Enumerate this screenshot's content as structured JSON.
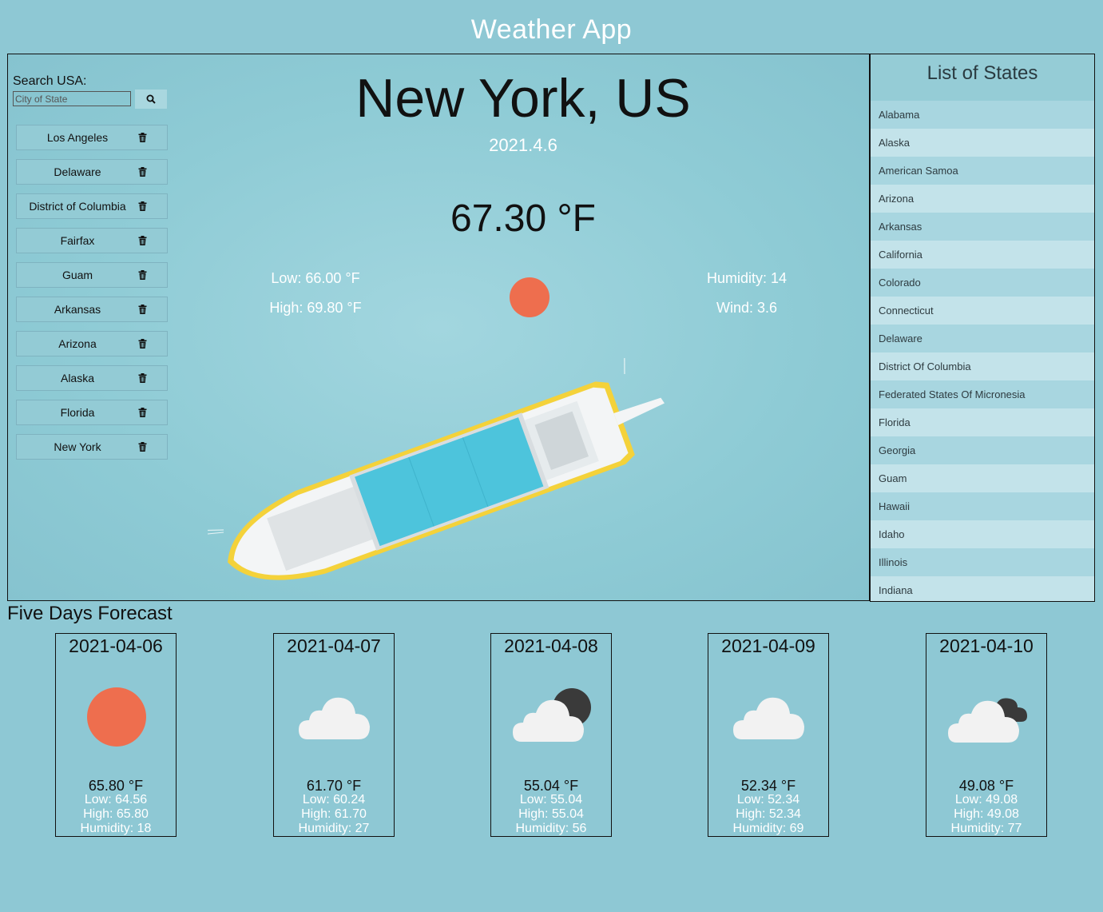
{
  "app_title": "Weather App",
  "search": {
    "label": "Search USA:",
    "placeholder": "City of State",
    "button_icon": "search-icon"
  },
  "history": [
    {
      "label": "Los Angeles"
    },
    {
      "label": "Delaware"
    },
    {
      "label": "District of Columbia"
    },
    {
      "label": "Fairfax"
    },
    {
      "label": "Guam"
    },
    {
      "label": "Arkansas"
    },
    {
      "label": "Arizona"
    },
    {
      "label": "Alaska"
    },
    {
      "label": "Florida"
    },
    {
      "label": "New York"
    }
  ],
  "current": {
    "city": "New York, US",
    "date": "2021.4.6",
    "temp": "67.30 °F",
    "low": "Low: 66.00 °F",
    "high": "High: 69.80 °F",
    "humidity": "Humidity: 14",
    "wind": "Wind: 3.6",
    "icon": "sun-icon"
  },
  "states": {
    "title": "List of States",
    "items": [
      "Alabama",
      "Alaska",
      "American Samoa",
      "Arizona",
      "Arkansas",
      "California",
      "Colorado",
      "Connecticut",
      "Delaware",
      "District Of Columbia",
      "Federated States Of Micronesia",
      "Florida",
      "Georgia",
      "Guam",
      "Hawaii",
      "Idaho",
      "Illinois",
      "Indiana"
    ]
  },
  "forecast": {
    "title": "Five Days Forecast",
    "days": [
      {
        "date": "2021-04-06",
        "temp": "65.80 °F",
        "low": "Low: 64.56",
        "high": "High: 65.80",
        "humidity": "Humidity: 18",
        "icon": "sun-icon"
      },
      {
        "date": "2021-04-07",
        "temp": "61.70 °F",
        "low": "Low: 60.24",
        "high": "High: 61.70",
        "humidity": "Humidity: 27",
        "icon": "cloud-icon"
      },
      {
        "date": "2021-04-08",
        "temp": "55.04 °F",
        "low": "Low: 55.04",
        "high": "High: 55.04",
        "humidity": "Humidity: 56",
        "icon": "cloud-dark-sun-icon"
      },
      {
        "date": "2021-04-09",
        "temp": "52.34 °F",
        "low": "Low: 52.34",
        "high": "High: 52.34",
        "humidity": "Humidity: 69",
        "icon": "cloud-icon"
      },
      {
        "date": "2021-04-10",
        "temp": "49.08 °F",
        "low": "Low: 49.08",
        "high": "High: 49.08",
        "humidity": "Humidity: 77",
        "icon": "broken-clouds-icon"
      }
    ]
  },
  "colors": {
    "sun": "#ee6e4e",
    "cloud": "#f2f2f2",
    "dark_cloud": "#3a3a3a",
    "text_light": "#ffffff"
  }
}
